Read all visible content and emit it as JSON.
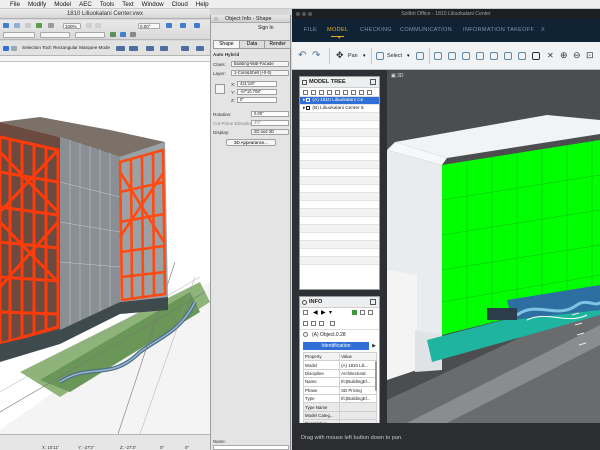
{
  "menubar": {
    "items": [
      "File",
      "Modify",
      "Model",
      "AEC",
      "Tools",
      "Text",
      "Window",
      "Cloud",
      "Help"
    ]
  },
  "vectorworks": {
    "title": "1810 Liliuokalani Center.vwx",
    "zoom": "100%",
    "angle": "0.00°",
    "hint": "Selection Tool: Rectangular Marquee Mode",
    "status_x": "X: 10'11\"",
    "status_y": "Y: -27'2\"",
    "status_z": "Z: -27'3\"",
    "status_dx": "0\"",
    "status_dy": "0\""
  },
  "object_info": {
    "title": "Object Info - Shape",
    "sign_in": "Sign In",
    "tabs": [
      "Shape",
      "Data",
      "Render"
    ],
    "object_type": "Auto Hybrid",
    "class_label": "Class:",
    "class_value": "Building-Wall-Facade",
    "layer_label": "Layer:",
    "layer_value": "1-Core&Shell (+0-0)",
    "x_label": "X:",
    "x_value": "421'1/8\"",
    "y_label": "Y:",
    "y_value": "-57'10.708\"",
    "z_label": "Z:",
    "z_value": "0\"",
    "rotation_label": "Rotation:",
    "rotation_value": "0.00°",
    "cut_plane_label": "Cut Plane Elevation:",
    "cut_plane_value": "4'0\"",
    "display_label": "Display:",
    "display_value": "2D and 3D",
    "appearance_button": "3D Appearance...",
    "name_label": "Name:"
  },
  "solibri": {
    "title": "Solibri Office - 1810 Liliuokalani Center",
    "nav_tabs": [
      "FILE",
      "MODEL",
      "CHECKING",
      "COMMUNICATION",
      "INFORMATION TAKEOFF",
      "X"
    ],
    "active_tab": "MODEL",
    "toolbar": {
      "pan_label": "Pan",
      "select_label": "Select"
    },
    "model_tree": {
      "title": "MODEL TREE",
      "items": [
        "(A) 1810 Liliuokalani Ce",
        "(B) Liliuokalani Center 5"
      ]
    },
    "info": {
      "title": "INFO",
      "object": "(A) Object.0.28",
      "section": "Identification",
      "columns": [
        "Property",
        "Value"
      ],
      "rows": [
        [
          "Model",
          "(A) 1810 Lili..."
        ],
        [
          "Discipline",
          "Architectural"
        ],
        [
          "Name",
          "Ifc(BuildingEl..."
        ],
        [
          "Phase",
          "SD Pricing"
        ],
        [
          "Type",
          "Ifc(BuildingEl..."
        ],
        [
          "Type Name",
          ""
        ],
        [
          "Model Categ...",
          ""
        ],
        [
          "Description",
          ""
        ],
        [
          "Material",
          "Default"
        ]
      ]
    },
    "view_label": "3D",
    "status": "Drag with mouse left button down to pan."
  },
  "colors": {
    "facade_orange": "#ff3b0a",
    "solibri_green": "#00ff00",
    "solibri_nav": "#0f2335",
    "solibri_accent": "#f0a81a",
    "selection_blue": "#2f6fd6"
  }
}
